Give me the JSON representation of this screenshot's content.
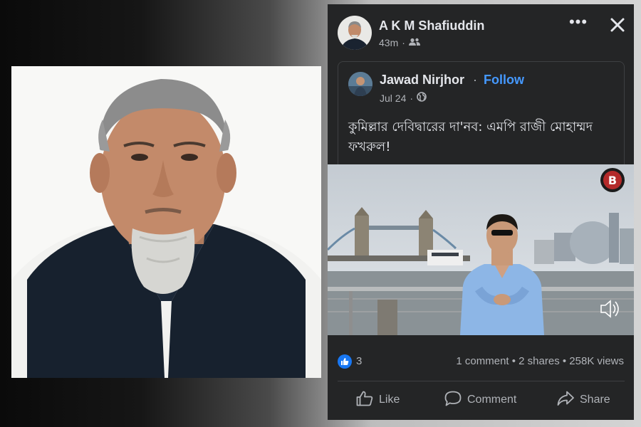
{
  "post": {
    "poster_name": "A K M Shafiuddin",
    "time": "43m",
    "audience_icon": "friends-icon"
  },
  "shared_post": {
    "author_name": "Jawad Nirjhor",
    "separator": "·",
    "follow_label": "Follow",
    "date": "Jul 24",
    "audience_icon": "globe-icon",
    "text": "কুমিল্লার দেবিদ্বারের দা'নব: এমপি রাজী মোহাম্মদ ফখরুল!"
  },
  "stats": {
    "reaction_count": "3",
    "summary": "1 comment • 2 shares • 258K views"
  },
  "actions": {
    "like_label": "Like",
    "comment_label": "Comment",
    "share_label": "Share"
  },
  "video": {
    "channel_logo_text": "B"
  },
  "colors": {
    "card_bg": "#242526",
    "text_primary": "#e4e6eb",
    "text_secondary": "#b0b3b8",
    "follow_blue": "#4599ff",
    "like_blue": "#1877f2"
  }
}
